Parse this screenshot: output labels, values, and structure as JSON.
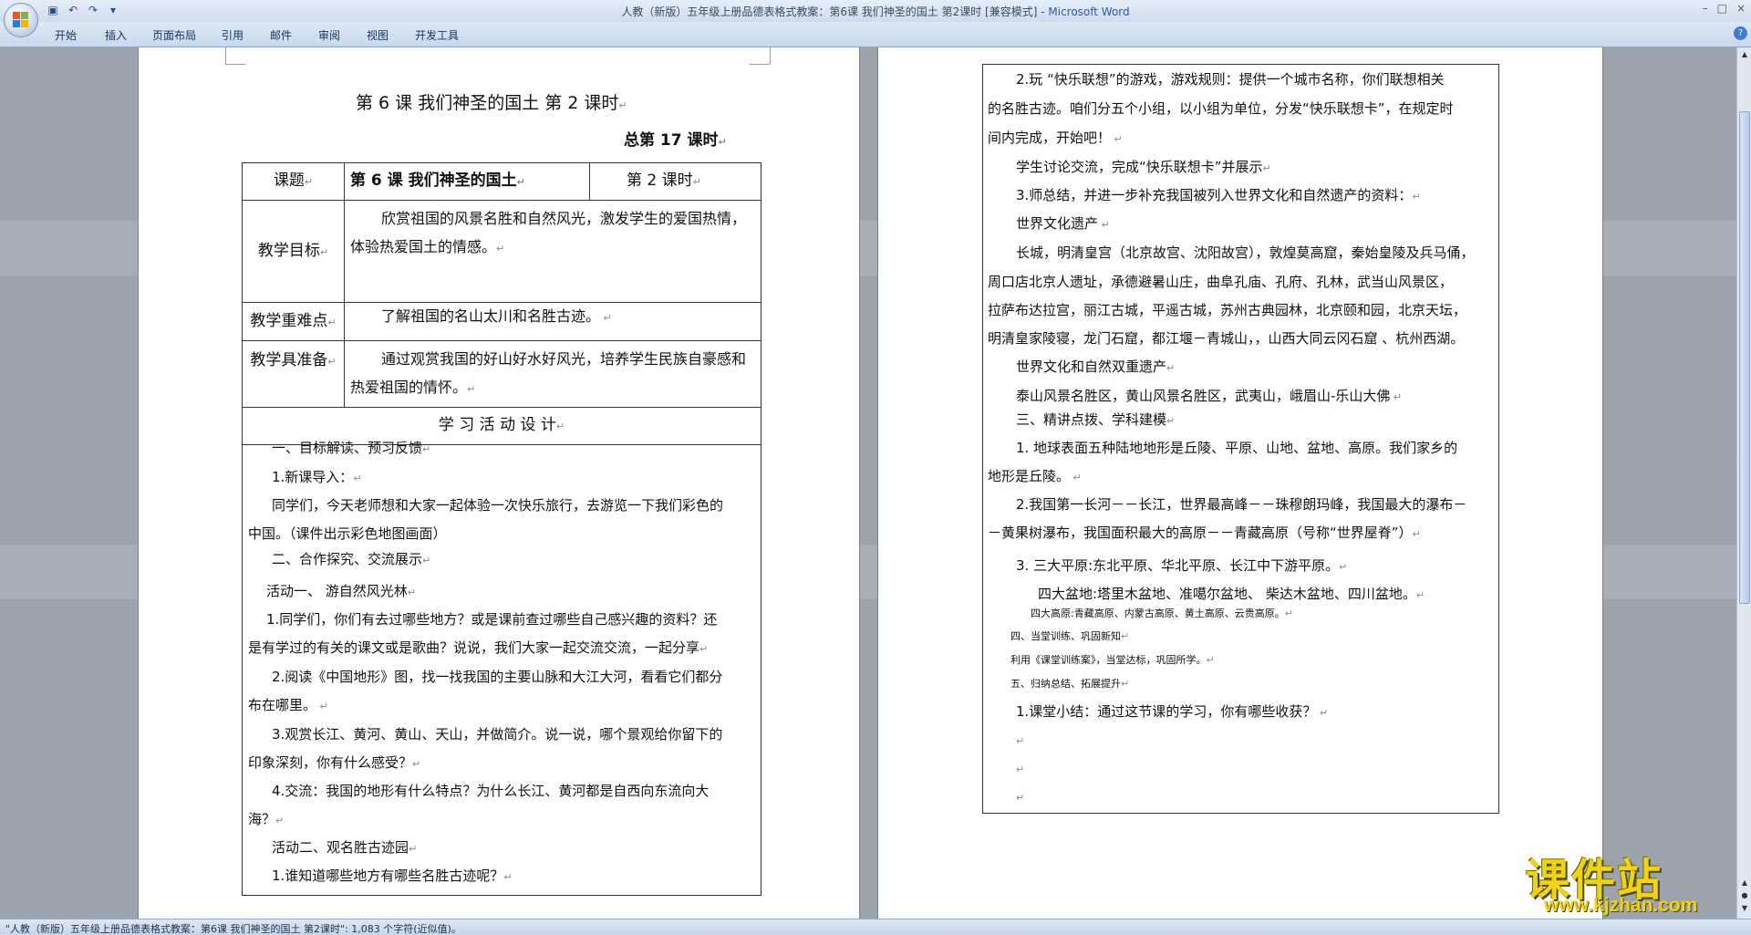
{
  "window": {
    "title": "人教（新版）五年级上册品德表格式教案：第6课 我们神圣的国土 第2课时 [兼容模式] - ",
    "app_name": "Microsoft Word",
    "controls": [
      "–",
      "□",
      "×"
    ]
  },
  "qat": {
    "icons": [
      "save-icon",
      "undo-icon",
      "redo-icon",
      "customize-icon"
    ]
  },
  "ribbon_tabs": [
    "开始",
    "插入",
    "页面布局",
    "引用",
    "邮件",
    "审阅",
    "视图",
    "开发工具"
  ],
  "left_page": {
    "heading": "第 6 课  我们神圣的国土  第 2 课时",
    "total_lesson": "总第    17    课时",
    "table": {
      "topic_label": "课题",
      "topic_value": "第 6 课 我们神圣的国土",
      "period_value": "第    2      课时",
      "goal_label": "教学目标",
      "goal_value": "欣赏祖国的风景名胜和自然风光，激发学生的爱国热情，体验热爱国土的情感。",
      "key_label": "教学重难点",
      "key_value": "了解祖国的名山太川和名胜古迹。",
      "tools_label": "教学具准备",
      "tools_value": "通过观赏我国的好山好水好风光，培养学生民族自豪感和热爱祖国的情怀。",
      "design_header": "学 习 活 动 设 计"
    },
    "lines": [
      "一、目标解读、预习反馈",
      "1.新课导入：",
      "同学们，今天老师想和大家一起体验一次快乐旅行，去游览一下我们彩色的",
      "中国。（课件出示彩色地图画面）",
      "二、合作探究、交流展示",
      "活动一、 游自然风光林",
      "1.同学们，你们有去过哪些地方？或是课前查过哪些自己感兴趣的资料？还",
      "是有学过的有关的课文或是歌曲？说说，我们大家一起交流交流，一起分享",
      "2.阅读《中国地形》图，找一找我国的主要山脉和大江大河，看看它们都分",
      "布在哪里。",
      "3.观赏长江、黄河、黄山、天山，并做简介。说一说，哪个景观给你留下的",
      "印象深刻，你有什么感受？",
      "4.交流：我国的地形有什么特点？为什么长江、黄河都是自西向东流向大",
      "海？",
      "活动二、观名胜古迹园",
      "1.谁知道哪些地方有哪些名胜古迹呢？"
    ]
  },
  "right_page": {
    "lines": [
      "2.玩 “快乐联想”的游戏，游戏规则：提供一个城市名称，你们联想相关",
      "的名胜古迹。咱们分五个小组，以小组为单位，分发“快乐联想卡”，在规定时",
      "间内完成，开始吧！",
      "学生讨论交流，完成“快乐联想卡”并展示",
      "3.师总结，并进一步补充我国被列入世界文化和自然遗产的资料：",
      "世界文化遗产",
      "长城，明清皇宫（北京故宫、沈阳故宫），敦煌莫高窟，秦始皇陵及兵马俑，",
      "周口店北京人遗址，承德避暑山庄，曲阜孔庙、孔府、孔林，武当山风景区，",
      "拉萨布达拉宫，丽江古城，平遥古城，苏州古典园林，北京颐和园，北京天坛，",
      "明清皇家陵寝，龙门石窟，都江堰－青城山，，山西大同云冈石窟 、杭州西湖。",
      "世界文化和自然双重遗产",
      "泰山风景名胜区，黄山风景名胜区，武夷山，峨眉山-乐山大佛",
      "三、精讲点拨、学科建模",
      "1.  地球表面五种陆地地形是丘陵、平原、山地、盆地、高原。我们家乡的",
      "地形是丘陵。",
      "2.我国第一长河－－长江，世界最高峰－－珠穆朗玛峰，我国最大的瀑布－",
      "－黄果树瀑布，我国面积最大的高原－－青藏高原（号称“世界屋脊”）",
      "3. 三大平原:东北平原、华北平原、长江中下游平原。",
      "四大盆地:塔里木盆地、准噶尔盆地、 柴达木盆地、四川盆地。",
      "四大高原:青藏高原、内蒙古高原、黄土高原、云贵高原。",
      "四、当堂训练、巩固新知",
      "利用《课堂训练案》，当堂达标，巩固所学。",
      "五、归纳总结、拓展提升",
      "1.课堂小结：通过这节课的学习，你有哪些收获？"
    ]
  },
  "status_bar": {
    "text": "\"人教（新版）五年级上册品德表格式教案：第6课 我们神圣的国土 第2课时\": 1,083 个字符(近似值)。"
  },
  "watermark": {
    "title": "课件站",
    "url": "www.kjzhan.com"
  },
  "colors": {
    "accent": "#2e59a8",
    "watermark": "#f0d21a"
  }
}
